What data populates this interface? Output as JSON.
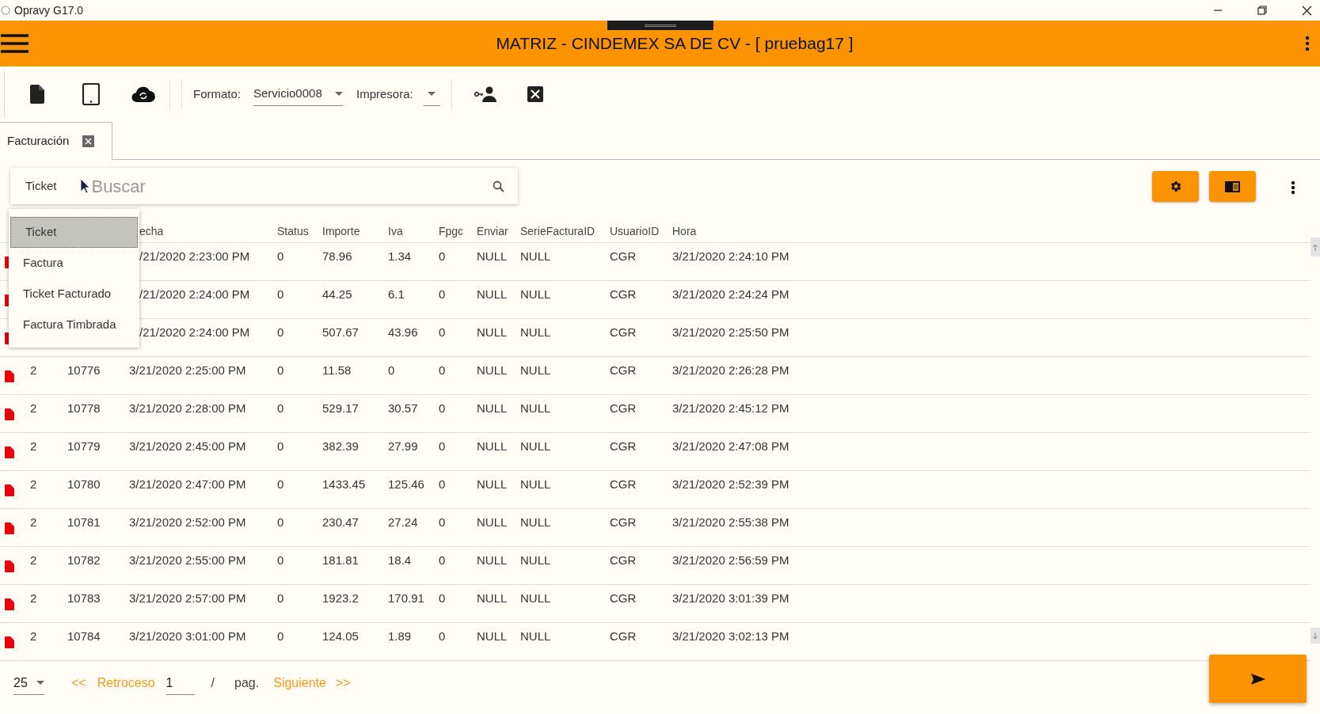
{
  "window": {
    "title": "Opravy G17.0"
  },
  "app_bar": {
    "title": "MATRIZ - CINDEMEX SA DE CV - [ pruebag17 ]"
  },
  "toolbar": {
    "formato_label": "Formato:",
    "formato_value": "Servicio0008",
    "impresora_label": "Impresora:"
  },
  "tabs": [
    {
      "label": "Facturación",
      "selected": true
    }
  ],
  "search": {
    "filter": "Ticket",
    "placeholder": "Buscar"
  },
  "filter_menu": [
    {
      "label": "Ticket",
      "selected": true
    },
    {
      "label": "Factura",
      "selected": false
    },
    {
      "label": "Ticket Facturado",
      "selected": false
    },
    {
      "label": "Factura Timbrada",
      "selected": false
    }
  ],
  "table": {
    "columns": [
      "echa",
      "Status",
      "Importe",
      "Iva",
      "Fpgc",
      "Enviar",
      "SerieFacturaID",
      "UsuarioID",
      "Hora"
    ],
    "rows": [
      {
        "cells": [
          "/21/2020 2:23:00 PM",
          "0",
          "78.96",
          "1.34",
          "0",
          "NULL",
          "NULL",
          "CGR",
          "3/21/2020 2:24:10 PM"
        ]
      },
      {
        "cells": [
          "/21/2020 2:24:00 PM",
          "0",
          "44.25",
          "6.1",
          "0",
          "NULL",
          "NULL",
          "CGR",
          "3/21/2020 2:24:24 PM"
        ]
      },
      {
        "cells": [
          "/21/2020 2:24:00 PM",
          "0",
          "507.67",
          "43.96",
          "0",
          "NULL",
          "NULL",
          "CGR",
          "3/21/2020 2:25:50 PM"
        ]
      },
      {
        "cells": [
          "2",
          "10776",
          "3/21/2020 2:25:00 PM",
          "0",
          "11.58",
          "0",
          "0",
          "NULL",
          "NULL",
          "CGR",
          "3/21/2020 2:26:28 PM"
        ]
      },
      {
        "cells": [
          "2",
          "10778",
          "3/21/2020 2:28:00 PM",
          "0",
          "529.17",
          "30.57",
          "0",
          "NULL",
          "NULL",
          "CGR",
          "3/21/2020 2:45:12 PM"
        ]
      },
      {
        "cells": [
          "2",
          "10779",
          "3/21/2020 2:45:00 PM",
          "0",
          "382.39",
          "27.99",
          "0",
          "NULL",
          "NULL",
          "CGR",
          "3/21/2020 2:47:08 PM"
        ]
      },
      {
        "cells": [
          "2",
          "10780",
          "3/21/2020 2:47:00 PM",
          "0",
          "1433.45",
          "125.46",
          "0",
          "NULL",
          "NULL",
          "CGR",
          "3/21/2020 2:52:39 PM"
        ]
      },
      {
        "cells": [
          "2",
          "10781",
          "3/21/2020 2:52:00 PM",
          "0",
          "230.47",
          "27.24",
          "0",
          "NULL",
          "NULL",
          "CGR",
          "3/21/2020 2:55:38 PM"
        ]
      },
      {
        "cells": [
          "2",
          "10782",
          "3/21/2020 2:55:00 PM",
          "0",
          "181.81",
          "18.4",
          "0",
          "NULL",
          "NULL",
          "CGR",
          "3/21/2020 2:56:59 PM"
        ]
      },
      {
        "cells": [
          "2",
          "10783",
          "3/21/2020 2:57:00 PM",
          "0",
          "1923.2",
          "170.91",
          "0",
          "NULL",
          "NULL",
          "CGR",
          "3/21/2020 3:01:39 PM"
        ]
      },
      {
        "cells": [
          "2",
          "10784",
          "3/21/2020 3:01:00 PM",
          "0",
          "124.05",
          "1.89",
          "0",
          "NULL",
          "NULL",
          "CGR",
          "3/21/2020 3:02:13 PM"
        ]
      }
    ]
  },
  "pagination": {
    "page_size": "25",
    "prev_arrows": "<<",
    "prev": "Retroceso",
    "page": "1",
    "separator": "/",
    "page_label": "pag.",
    "next": "Siguiente",
    "next_arrows": ">>"
  }
}
